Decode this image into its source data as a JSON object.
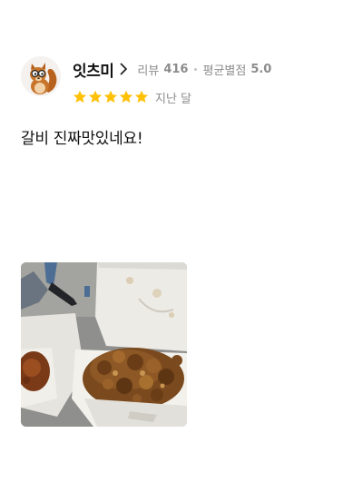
{
  "review": {
    "user": {
      "name": "잇츠미",
      "avatar_icon": "squirrel-avatar-icon"
    },
    "stats": {
      "reviews_label": "리뷰",
      "reviews_count": "416",
      "avg_rating_label": "평균별점",
      "avg_rating_value": "5.0"
    },
    "rating": {
      "stars": 5,
      "max_stars": 5,
      "star_color": "#ffc107"
    },
    "date": "지난 달",
    "text": "갈비 진짜맛있네요!",
    "photo": {
      "icon": "food-photo"
    }
  }
}
